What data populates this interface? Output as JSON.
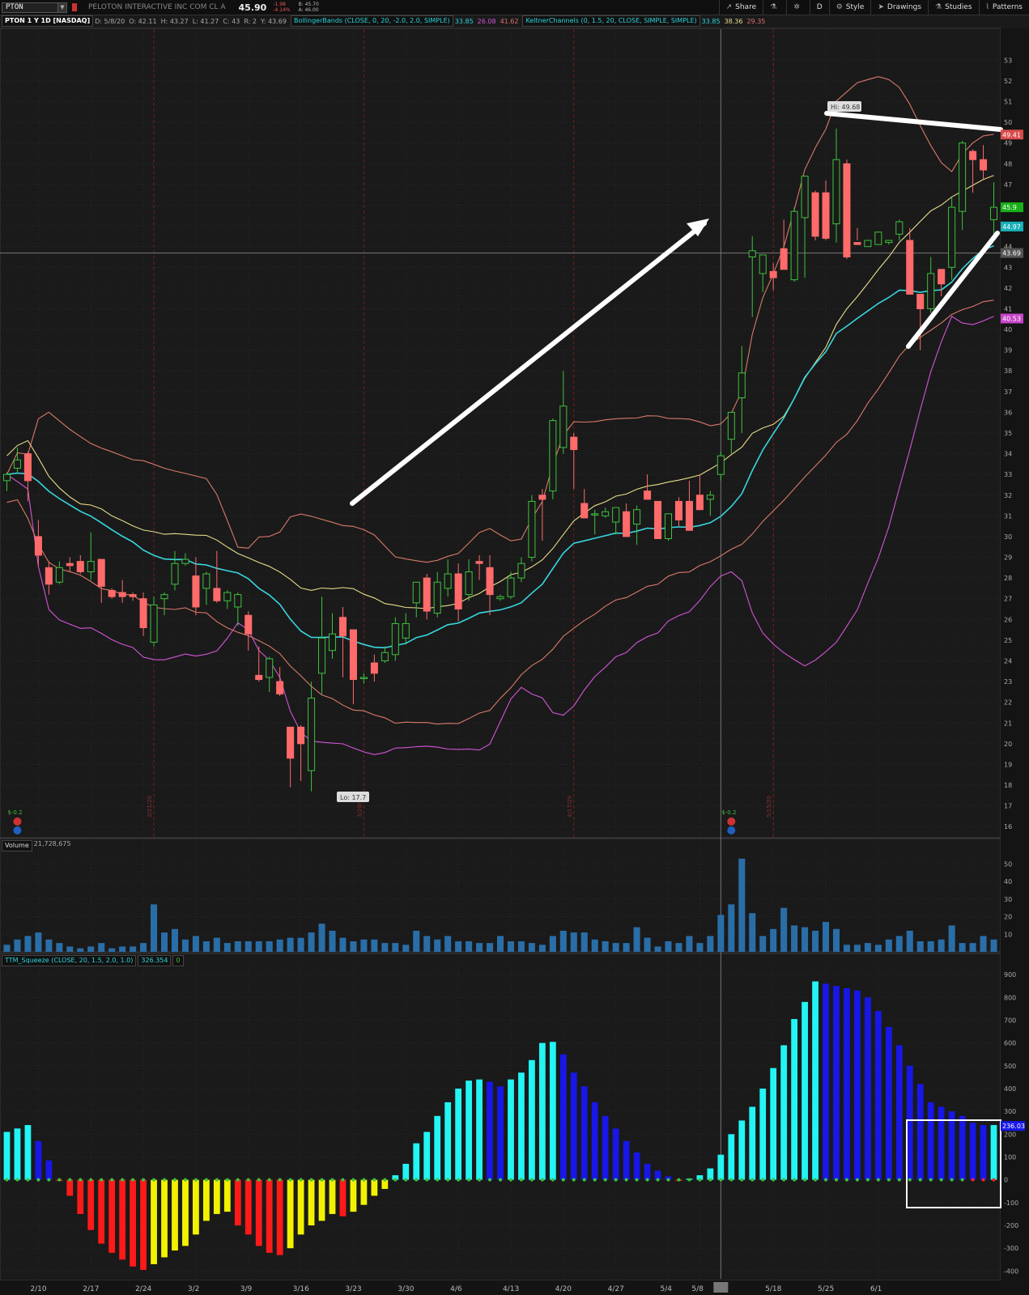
{
  "header": {
    "symbol": "PTON",
    "company": "PELOTON INTERACTIVE INC COM CL A",
    "last": "45.90",
    "change": "-1.98",
    "change_pct": "-4.14%",
    "bid": "B: 45.70",
    "ask": "A: 46.00"
  },
  "toolbar": {
    "share": "Share",
    "period": "D",
    "style": "Style",
    "drawings": "Drawings",
    "studies": "Studies",
    "patterns": "Patterns"
  },
  "study_bar": {
    "title": "PTON 1 Y 1D [NASDAQ]",
    "date": "D: 5/8/20",
    "open": "O: 42.11",
    "high": "H: 43.27",
    "low": "L: 41.27",
    "close": "C: 43",
    "range": "R: 2",
    "y": "Y: 43.69",
    "bb_label": "BollingerBands (CLOSE, 0, 20, -2.0, 2.0, SIMPLE)",
    "bb_v1": "33.85",
    "bb_v2": "26.08",
    "bb_v3": "41.62",
    "kc_label": "KeltnerChannels (0, 1.5, 20, CLOSE, SIMPLE, SIMPLE)",
    "kc_v1": "33.85",
    "kc_v2": "38.36",
    "kc_v3": "29.35"
  },
  "volume_pane": {
    "label": "Volume",
    "value": "21,728,675"
  },
  "squeeze_pane": {
    "label": "TTM_Squeeze (CLOSE, 20, 1.5, 2.0, 1.0)",
    "value": "326.354",
    "value2": "0"
  },
  "colors": {
    "up": "#3ec23e",
    "down": "#ff6b6b",
    "bb": "#d97a68",
    "kc_mid": "#e6dc8a",
    "kc_low": "#d255d8",
    "ema": "#38d6df",
    "hist_up_strong": "#23f4f4",
    "hist_up_weak": "#1717e8",
    "hist_dn_strong": "#ff1a1a",
    "hist_dn_weak": "#f2f200"
  },
  "chart_data": {
    "type": "candlestick",
    "x_ticks": [
      "2/10",
      "2/17",
      "2/24",
      "3/2",
      "3/9",
      "3/16",
      "3/23",
      "3/30",
      "4/6",
      "4/13",
      "4/20",
      "4/27",
      "5/4",
      "5/8",
      "5/18",
      "5/25",
      "6/1"
    ],
    "earnings_labels": [
      "2/21/20",
      "3/20/20",
      "4/17/20",
      "5/15/20"
    ],
    "price_axis": {
      "min": 16,
      "max": 53,
      "ticks": [
        16,
        17,
        18,
        19,
        20,
        21,
        22,
        23,
        24,
        25,
        26,
        27,
        28,
        29,
        30,
        31,
        32,
        33,
        34,
        35,
        36,
        37,
        38,
        39,
        40,
        41,
        42,
        43,
        44,
        45,
        46,
        47,
        48,
        49,
        50,
        51,
        52,
        53
      ]
    },
    "price_tags": [
      {
        "value": "49.41",
        "color": "#d94b4b"
      },
      {
        "value": "45.9",
        "color": "#18b018"
      },
      {
        "value": "44.97",
        "color": "#1ab0b8"
      },
      {
        "value": "43.69",
        "color": "#555555"
      },
      {
        "value": "40.53",
        "color": "#c845c8"
      }
    ],
    "annotations": {
      "hi": "Hi: 49.68",
      "lo": "Lo: 17.7",
      "div1": "$-0.2",
      "div2": "$-0.2"
    },
    "candles": [
      [
        32.7,
        33.1,
        32.2,
        33.0
      ],
      [
        33.3,
        34.3,
        33.1,
        33.7
      ],
      [
        34.0,
        34.1,
        31.7,
        32.7
      ],
      [
        30.0,
        30.8,
        28.6,
        29.1
      ],
      [
        28.5,
        28.8,
        27.2,
        27.7
      ],
      [
        27.8,
        28.8,
        27.7,
        28.5
      ],
      [
        28.7,
        29.0,
        28.3,
        28.6
      ],
      [
        28.8,
        29.1,
        28.2,
        28.3
      ],
      [
        28.3,
        30.2,
        27.9,
        28.8
      ],
      [
        28.9,
        28.9,
        26.8,
        27.6
      ],
      [
        27.4,
        27.5,
        27.0,
        27.1
      ],
      [
        27.3,
        27.9,
        26.8,
        27.1
      ],
      [
        27.2,
        27.3,
        26.9,
        27.1
      ],
      [
        27.0,
        27.3,
        25.2,
        25.6
      ],
      [
        24.9,
        27.1,
        24.7,
        26.7
      ],
      [
        27.0,
        27.3,
        26.2,
        27.2
      ],
      [
        27.7,
        29.3,
        27.4,
        28.7
      ],
      [
        28.7,
        29.2,
        28.6,
        28.9
      ],
      [
        28.1,
        29.0,
        26.2,
        26.6
      ],
      [
        27.5,
        28.3,
        26.7,
        28.2
      ],
      [
        27.5,
        29.3,
        26.8,
        26.9
      ],
      [
        26.9,
        27.4,
        26.5,
        27.3
      ],
      [
        26.6,
        27.3,
        25.7,
        27.2
      ],
      [
        26.2,
        26.4,
        24.5,
        25.3
      ],
      [
        23.3,
        24.7,
        23.0,
        23.1
      ],
      [
        23.2,
        24.2,
        22.5,
        24.1
      ],
      [
        23.0,
        23.7,
        22.3,
        22.4
      ],
      [
        20.8,
        20.8,
        17.9,
        19.3
      ],
      [
        20.8,
        20.9,
        18.2,
        20.0
      ],
      [
        18.7,
        23.0,
        17.7,
        22.2
      ],
      [
        23.4,
        27.1,
        22.4,
        25.1
      ],
      [
        24.5,
        26.3,
        24.1,
        25.3
      ],
      [
        26.1,
        26.6,
        23.2,
        25.2
      ],
      [
        25.5,
        25.5,
        21.9,
        23.1
      ],
      [
        23.2,
        23.4,
        22.9,
        23.2
      ],
      [
        23.9,
        24.3,
        23.0,
        23.4
      ],
      [
        24.0,
        24.7,
        23.9,
        24.4
      ],
      [
        24.3,
        26.1,
        24.0,
        25.8
      ],
      [
        25.1,
        26.3,
        24.8,
        25.8
      ],
      [
        26.8,
        27.7,
        26.1,
        27.8
      ],
      [
        28.0,
        28.2,
        26.0,
        26.4
      ],
      [
        26.3,
        28.3,
        26.1,
        27.8
      ],
      [
        27.5,
        28.9,
        27.1,
        28.2
      ],
      [
        28.2,
        28.7,
        25.9,
        26.5
      ],
      [
        27.2,
        28.9,
        26.9,
        28.3
      ],
      [
        28.8,
        29.1,
        27.9,
        28.7
      ],
      [
        28.5,
        29.1,
        26.2,
        27.2
      ],
      [
        27.0,
        27.2,
        26.9,
        27.1
      ],
      [
        27.1,
        28.3,
        27.0,
        28.0
      ],
      [
        28.0,
        29.0,
        27.8,
        28.7
      ],
      [
        29.0,
        32.0,
        28.8,
        31.7
      ],
      [
        32.0,
        32.3,
        29.8,
        31.8
      ],
      [
        32.2,
        35.7,
        31.8,
        35.6
      ],
      [
        34.3,
        38.0,
        34.0,
        36.3
      ],
      [
        34.8,
        35.0,
        32.3,
        34.2
      ],
      [
        31.6,
        32.3,
        31.0,
        30.9
      ],
      [
        31.1,
        31.3,
        30.1,
        31.1
      ],
      [
        31.0,
        31.4,
        30.9,
        31.2
      ],
      [
        30.7,
        31.4,
        30.1,
        31.4
      ],
      [
        31.2,
        31.6,
        30.1,
        30.0
      ],
      [
        30.6,
        31.5,
        29.6,
        31.3
      ],
      [
        32.2,
        33.0,
        31.8,
        31.8
      ],
      [
        31.7,
        31.5,
        29.9,
        29.9
      ],
      [
        29.9,
        30.4,
        29.8,
        31.1
      ],
      [
        31.7,
        31.9,
        30.5,
        30.8
      ],
      [
        31.7,
        32.7,
        30.8,
        30.3
      ],
      [
        32.0,
        33.0,
        31.6,
        31.3
      ],
      [
        31.8,
        32.2,
        31.0,
        32.0
      ],
      [
        33.0,
        34.1,
        32.7,
        33.9
      ],
      [
        34.7,
        35.8,
        34.0,
        36.0
      ],
      [
        36.7,
        39.2,
        35.0,
        37.9
      ],
      [
        43.5,
        44.5,
        40.6,
        43.8
      ],
      [
        42.7,
        42.9,
        41.8,
        43.6
      ],
      [
        42.8,
        43.2,
        41.9,
        42.5
      ],
      [
        43.9,
        45.3,
        43.5,
        42.9
      ],
      [
        42.4,
        45.9,
        42.3,
        45.7
      ],
      [
        45.4,
        47.0,
        42.5,
        47.4
      ],
      [
        46.6,
        46.7,
        44.3,
        44.5
      ],
      [
        46.6,
        47.2,
        44.3,
        44.4
      ],
      [
        45.1,
        49.7,
        44.2,
        48.2
      ],
      [
        48.0,
        48.2,
        43.4,
        43.5
      ],
      [
        44.2,
        44.9,
        44.3,
        44.1
      ],
      [
        44.0,
        44.0,
        44.0,
        44.3
      ],
      [
        44.1,
        44.5,
        44.1,
        44.7
      ],
      [
        44.2,
        44.2,
        44.1,
        44.3
      ],
      [
        44.6,
        45.3,
        44.3,
        45.2
      ],
      [
        44.3,
        44.9,
        44.0,
        41.7
      ],
      [
        41.7,
        41.6,
        39.0,
        41.0
      ],
      [
        41.0,
        43.5,
        40.8,
        42.7
      ],
      [
        42.9,
        42.9,
        41.6,
        42.2
      ],
      [
        43.0,
        46.4,
        42.4,
        45.9
      ],
      [
        45.7,
        49.1,
        44.8,
        49.0
      ],
      [
        48.6,
        48.7,
        46.6,
        48.2
      ],
      [
        48.2,
        48.9,
        47.2,
        47.7
      ],
      [
        45.3,
        47.1,
        44.3,
        45.9
      ]
    ],
    "volume": [
      4,
      7,
      9,
      11,
      7,
      5,
      3,
      2,
      3,
      5,
      2,
      3,
      3,
      5,
      27,
      11,
      13,
      7,
      9,
      6,
      8,
      5,
      6,
      6,
      6,
      6,
      7,
      8,
      8,
      11,
      16,
      12,
      8,
      6,
      7,
      7,
      5,
      5,
      4,
      12,
      9,
      7,
      9,
      6,
      6,
      5,
      5,
      9,
      6,
      6,
      5,
      4,
      9,
      12,
      11,
      11,
      7,
      6,
      5,
      5,
      14,
      8,
      3,
      6,
      5,
      9,
      5,
      9,
      21,
      27,
      53,
      22,
      9,
      13,
      25,
      15,
      14,
      12,
      17,
      13,
      4,
      4,
      5,
      4,
      7,
      9,
      12,
      6,
      6,
      7,
      15,
      5,
      5,
      9,
      7
    ],
    "squeeze": [
      210,
      225,
      240,
      170,
      85,
      -5,
      -70,
      -150,
      -220,
      -280,
      -320,
      -350,
      -380,
      -395,
      -370,
      -340,
      -310,
      -290,
      -240,
      -180,
      -150,
      -140,
      -200,
      -240,
      -290,
      -320,
      -330,
      -300,
      -240,
      -200,
      -180,
      -150,
      -160,
      -140,
      -110,
      -70,
      -40,
      20,
      70,
      160,
      210,
      280,
      340,
      400,
      435,
      440,
      430,
      410,
      440,
      470,
      525,
      600,
      605,
      550,
      470,
      410,
      340,
      280,
      225,
      170,
      120,
      70,
      40,
      15,
      -5,
      5,
      20,
      50,
      110,
      200,
      260,
      320,
      400,
      490,
      590,
      705,
      780,
      870,
      860,
      850,
      840,
      830,
      800,
      740,
      670,
      590,
      500,
      420,
      340,
      320,
      300,
      280,
      250,
      240,
      240
    ]
  }
}
